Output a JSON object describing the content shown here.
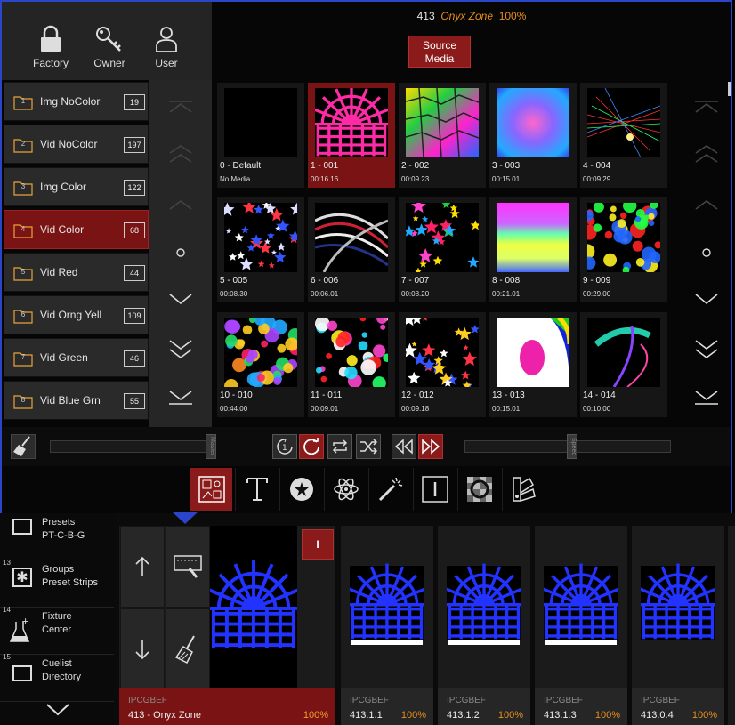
{
  "header": {
    "num": "413",
    "zone": "Onyx Zone",
    "pct": "100%"
  },
  "top_buttons": [
    {
      "label": "Factory",
      "icon": "lock-icon"
    },
    {
      "label": "Owner",
      "icon": "key-icon"
    },
    {
      "label": "User",
      "icon": "user-icon"
    }
  ],
  "source_button": "Source\nMedia",
  "folders": [
    {
      "num": "1",
      "name": "Img NoColor",
      "count": "19"
    },
    {
      "num": "2",
      "name": "Vid NoColor",
      "count": "197"
    },
    {
      "num": "3",
      "name": "Img Color",
      "count": "122"
    },
    {
      "num": "4",
      "name": "Vid Color",
      "count": "68"
    },
    {
      "num": "5",
      "name": "Vid Red",
      "count": "44"
    },
    {
      "num": "6",
      "name": "Vid Orng Yell",
      "count": "109"
    },
    {
      "num": "7",
      "name": "Vid Green",
      "count": "46"
    },
    {
      "num": "8",
      "name": "Vid Blue Grn",
      "count": "55"
    }
  ],
  "active_folder": 3,
  "media": [
    {
      "name": "0 - Default",
      "dur": "No Media"
    },
    {
      "name": "1 - 001",
      "dur": "00:16.16"
    },
    {
      "name": "2 - 002",
      "dur": "00:09.23"
    },
    {
      "name": "3 - 003",
      "dur": "00:15.01"
    },
    {
      "name": "4 - 004",
      "dur": "00:09.29"
    },
    {
      "name": "5 - 005",
      "dur": "00:08.30"
    },
    {
      "name": "6 - 006",
      "dur": "00:06.01"
    },
    {
      "name": "7 - 007",
      "dur": "00:08.20"
    },
    {
      "name": "8 - 008",
      "dur": "00:21.01"
    },
    {
      "name": "9 - 009",
      "dur": "00:29.00"
    },
    {
      "name": "10 - 010",
      "dur": "00:44.00"
    },
    {
      "name": "11 - 011",
      "dur": "00:09.01"
    },
    {
      "name": "12 - 012",
      "dur": "00:09.18"
    },
    {
      "name": "13 - 013",
      "dur": "00:15.01"
    },
    {
      "name": "14 - 014",
      "dur": "00:10.00"
    }
  ],
  "selected_media": 1,
  "transport": {
    "master_label": "Master",
    "speed_label": "Speed"
  },
  "bottom_left": [
    {
      "num": "",
      "l1": "Presets",
      "l2": "PT-C-B-G",
      "icon": "square-icon"
    },
    {
      "num": "13",
      "l1": "Groups",
      "l2": "Preset Strips",
      "icon": "asterisk-box-icon"
    },
    {
      "num": "14",
      "l1": "Fixture",
      "l2": "Center",
      "icon": "flask-icon"
    },
    {
      "num": "15",
      "l1": "Cuelist",
      "l2": "Directory",
      "icon": "square-icon"
    }
  ],
  "zones": [
    {
      "tag": "IPCGBEF",
      "name": "413 - Onyx Zone",
      "pct": "100%",
      "badge": "I"
    },
    {
      "tag": "IPCGBEF",
      "name": "413.1.1",
      "pct": "100%"
    },
    {
      "tag": "IPCGBEF",
      "name": "413.1.2",
      "pct": "100%"
    },
    {
      "tag": "IPCGBEF",
      "name": "413.1.3",
      "pct": "100%"
    },
    {
      "tag": "IPCGBEF",
      "name": "413.0.4",
      "pct": "100%"
    }
  ],
  "colors": {
    "accent_red": "#8b1a1a",
    "accent_orange": "#e8901a",
    "border_blue": "#2a45c8"
  }
}
